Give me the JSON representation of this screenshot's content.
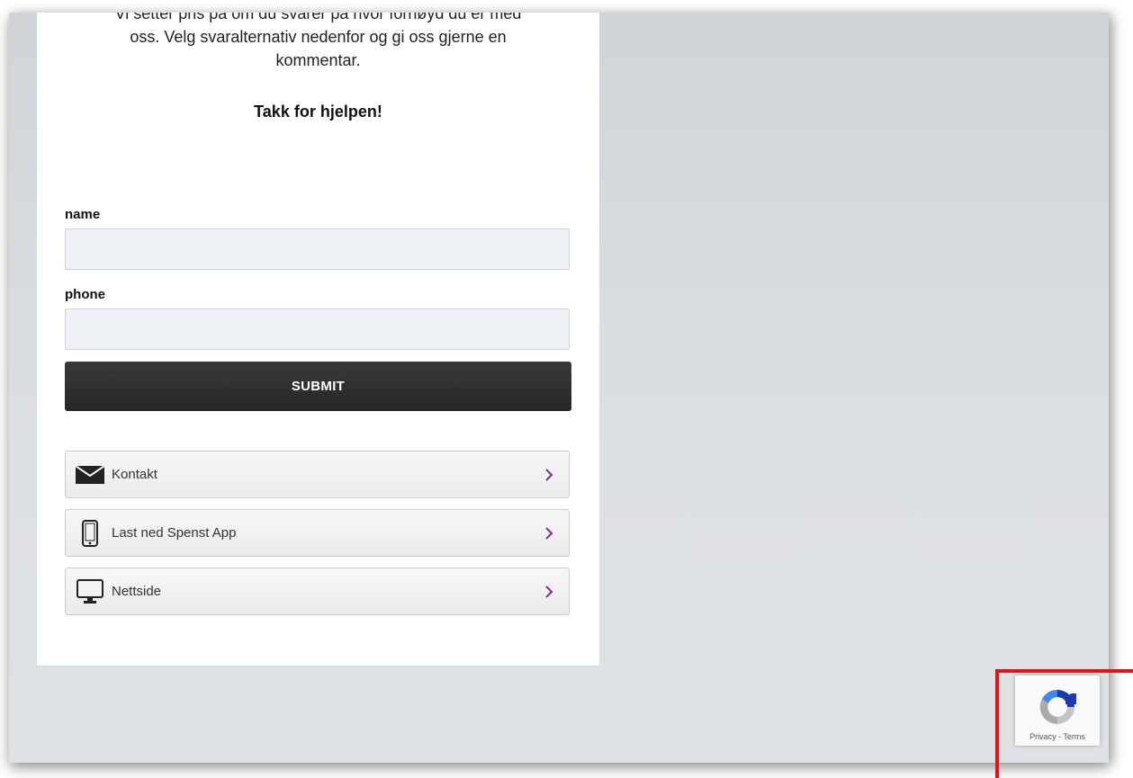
{
  "intro": {
    "line_clipped": "Vi setter pris på om du svarer på hvor fornøyd du er med",
    "line2": "oss. Velg svaralternativ nedenfor og gi oss gjerne en",
    "line3": "kommentar."
  },
  "thanks": "Takk for hjelpen!",
  "form": {
    "name_label": "name",
    "name_value": "",
    "phone_label": "phone",
    "phone_value": "",
    "submit_label": "SUBMIT"
  },
  "links": [
    {
      "label": "Kontakt",
      "icon": "envelope-icon"
    },
    {
      "label": "Last ned Spenst App",
      "icon": "smartphone-icon"
    },
    {
      "label": "Nettside",
      "icon": "desktop-monitor-icon"
    }
  ],
  "recaptcha": {
    "privacy": "Privacy",
    "separator": " - ",
    "terms": "Terms"
  },
  "colors": {
    "chevron": "#8a2a8a",
    "submit_bg": "#2b2b2b",
    "highlight": "#e0141b",
    "page_bg": "#dcdfe2"
  }
}
